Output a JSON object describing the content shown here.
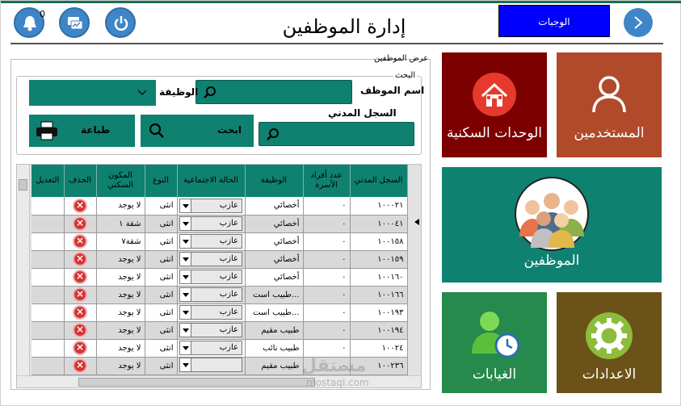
{
  "header": {
    "title": "إدارة الموظفين",
    "dues_button": "الوجبات",
    "notification_count": "0"
  },
  "panel": {
    "label": "عرض الموظفين",
    "search_legend": "البحث",
    "employee_name_label": "اسم الموظف",
    "job_label": "الوظيفة",
    "civil_record_label": "السجل المدني",
    "search_button": "ابحث",
    "print_button": "طباعة"
  },
  "table": {
    "columns": [
      "السجل المدني",
      "عدد أفراد الأسرة",
      "الوظيفة",
      "الحالة الاجتماعية",
      "النوع",
      "المكون السكني",
      "الحذف",
      "التعديل"
    ],
    "rows": [
      {
        "civil": "١٠٠٠٢١",
        "family": "٠",
        "job": "أخصائي",
        "status": "عازب",
        "gender": "انثى",
        "housing": "لا يوجد"
      },
      {
        "civil": "١٠٠٠٤١",
        "family": "٠",
        "job": "أخصائي",
        "status": "عازب",
        "gender": "انثى",
        "housing": "شقة ١"
      },
      {
        "civil": "١٠٠١٥٨",
        "family": "٠",
        "job": "أخصائي",
        "status": "عازب",
        "gender": "انثى",
        "housing": "شقة٧"
      },
      {
        "civil": "١٠٠١٥٩",
        "family": "٠",
        "job": "أخصائي",
        "status": "عازب",
        "gender": "انثى",
        "housing": "لا يوجد"
      },
      {
        "civil": "١٠٠١٦٠",
        "family": "٠",
        "job": "أخصائي",
        "status": "عازب",
        "gender": "انثى",
        "housing": "لا يوجد"
      },
      {
        "civil": "١٠٠١٦٦",
        "family": "٠",
        "job": "طبيب است...",
        "status": "عازب",
        "gender": "انثى",
        "housing": "لا يوجد"
      },
      {
        "civil": "١٠٠١٩٣",
        "family": "٠",
        "job": "طبيب است...",
        "status": "عازب",
        "gender": "انثى",
        "housing": "لا يوجد"
      },
      {
        "civil": "١٠٠١٩٤",
        "family": "٠",
        "job": "طبيب مقيم",
        "status": "عازب",
        "gender": "انثى",
        "housing": "لا يوجد"
      },
      {
        "civil": "١٠٠٢٤",
        "family": "٠",
        "job": "طبيب نائب",
        "status": "عازب",
        "gender": "انثى",
        "housing": "لا يوجد"
      },
      {
        "civil": "١٠٠٢٣٦",
        "family": "٠",
        "job": "طبيب مقيم",
        "status": "",
        "gender": "انثى",
        "housing": "لا يوجد"
      }
    ]
  },
  "tiles": {
    "users": "المستخدمين",
    "housing": "الوحدات السكنية",
    "employees": "الموظفين",
    "settings": "الاعدادات",
    "absences": "الغيابات"
  },
  "watermark": {
    "text": "مستقل",
    "url": "mostaql.com"
  },
  "colors": {
    "teal": "#0f8170",
    "blue_button": "#0000ff",
    "users_tile": "#b04a2a",
    "housing_tile": "#7c0000",
    "settings_tile": "#6b5218",
    "absences_tile": "#258a4c"
  }
}
